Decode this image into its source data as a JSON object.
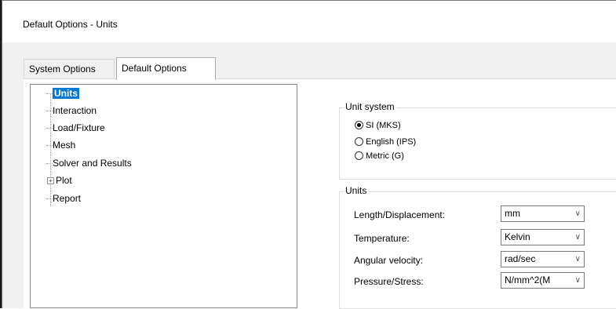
{
  "window": {
    "title": "Default Options - Units"
  },
  "tabs": [
    {
      "label": "System Options"
    },
    {
      "label": "Default Options"
    }
  ],
  "tree": {
    "items": [
      {
        "label": "Units"
      },
      {
        "label": "Interaction"
      },
      {
        "label": "Load/Fixture"
      },
      {
        "label": "Mesh"
      },
      {
        "label": "Solver and Results"
      },
      {
        "label": "Plot"
      },
      {
        "label": "Report"
      }
    ],
    "expander_symbol": "+"
  },
  "unit_system": {
    "title": "Unit system",
    "options": [
      {
        "label": "SI (MKS)"
      },
      {
        "label": "English (IPS)"
      },
      {
        "label": "Metric (G)"
      }
    ],
    "selected": "SI (MKS)"
  },
  "units": {
    "title": "Units",
    "rows": [
      {
        "label": "Length/Displacement:",
        "value": "mm"
      },
      {
        "label": "Temperature:",
        "value": "Kelvin"
      },
      {
        "label": "Angular velocity:",
        "value": "rad/sec"
      },
      {
        "label": "Pressure/Stress:",
        "value": "N/mm^2(M"
      }
    ],
    "chevron": "∨"
  },
  "colors": {
    "selection": "#0078d7",
    "dialog_bg": "#f0f0f0"
  }
}
